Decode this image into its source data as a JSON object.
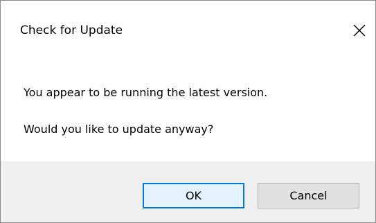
{
  "dialog": {
    "title": "Check for Update",
    "close_icon": "close-x-icon",
    "messages": [
      "You appear to be running the latest version.",
      "Would you like to update anyway?"
    ],
    "buttons": {
      "ok_label": "OK",
      "cancel_label": "Cancel"
    }
  },
  "colors": {
    "footer_bg": "#f0f0f0",
    "default_button_border": "#0078d7",
    "default_button_bg": "#e5f1fb",
    "button_bg": "#e1e1e1",
    "button_border": "#adadad"
  }
}
